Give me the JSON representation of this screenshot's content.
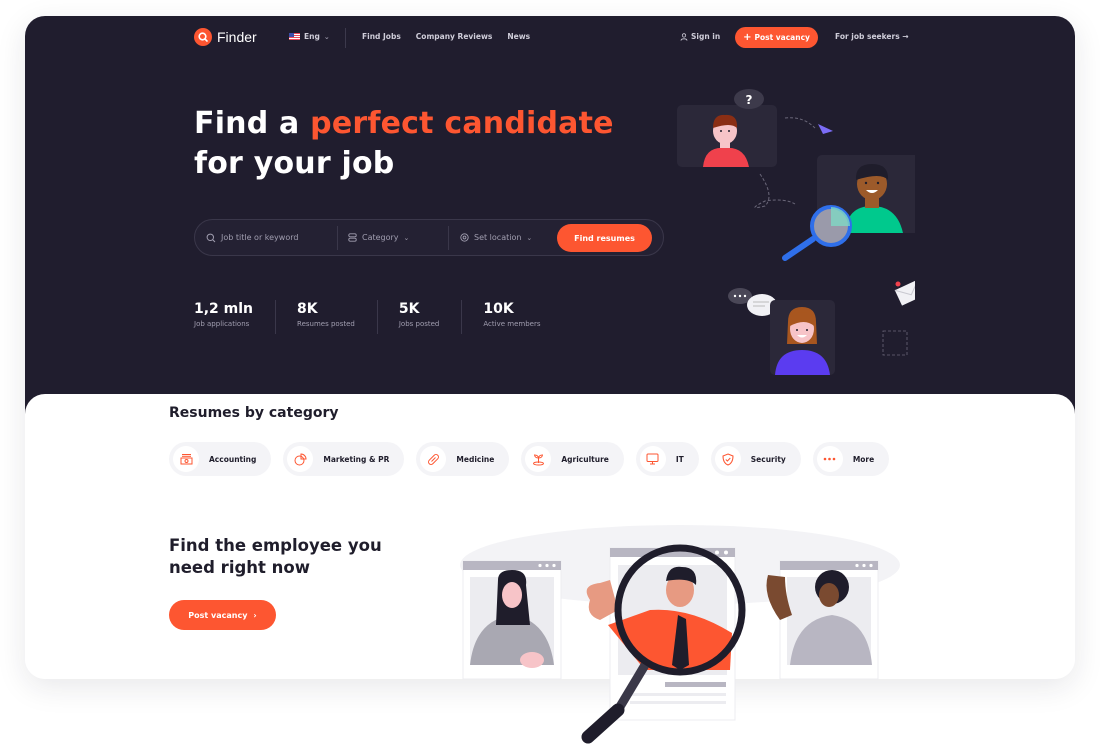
{
  "brand": {
    "name": "Finder",
    "accent": "#fd5631",
    "hero_bg": "#201d2e"
  },
  "nav": {
    "language": "Eng",
    "links": [
      "Find Jobs",
      "Company Reviews",
      "News"
    ],
    "sign_in": "Sign in",
    "post_vacancy": "Post vacancy",
    "for_job_seekers": "For job seekers"
  },
  "hero": {
    "title_part1": "Find a ",
    "title_accent": "perfect candidate",
    "title_part2": "for your job"
  },
  "search": {
    "keyword_placeholder": "Job title or keyword",
    "category_label": "Category",
    "location_label": "Set location",
    "submit_label": "Find resumes"
  },
  "stats": [
    {
      "value": "1,2 mln",
      "label": "Job applications"
    },
    {
      "value": "8K",
      "label": "Resumes posted"
    },
    {
      "value": "5K",
      "label": "Jobs posted"
    },
    {
      "value": "10K",
      "label": "Active members"
    }
  ],
  "categories": {
    "title": "Resumes by category",
    "items": [
      {
        "label": "Accounting",
        "icon": "cash-register-icon"
      },
      {
        "label": "Marketing & PR",
        "icon": "pie-chart-icon"
      },
      {
        "label": "Medicine",
        "icon": "pill-icon"
      },
      {
        "label": "Agriculture",
        "icon": "sprout-icon"
      },
      {
        "label": "IT",
        "icon": "monitor-icon"
      },
      {
        "label": "Security",
        "icon": "shield-check-icon"
      },
      {
        "label": "More",
        "icon": "dots-icon"
      }
    ]
  },
  "cta": {
    "title_line1": "Find the employee you",
    "title_line2": "need right now",
    "button": "Post vacancy"
  }
}
